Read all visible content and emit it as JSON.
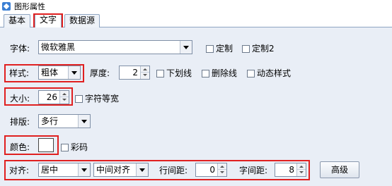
{
  "window": {
    "title": "图形属性",
    "icon": "shape-properties-icon"
  },
  "tabs": [
    {
      "label": "基本",
      "active": false
    },
    {
      "label": "文字",
      "active": true
    },
    {
      "label": "数据源",
      "active": false
    }
  ],
  "font": {
    "label": "字体:",
    "value": "微软雅黑",
    "custom1_label": "定制",
    "custom2_label": "定制2"
  },
  "style": {
    "label": "样式:",
    "value": "粗体",
    "thickness_label": "厚度:",
    "thickness_value": "2",
    "underline_label": "下划线",
    "strikethrough_label": "删除线",
    "dynamic_label": "动态样式"
  },
  "size": {
    "label": "大小:",
    "value": "26",
    "equal_width_label": "字符等宽"
  },
  "layout": {
    "label": "排版:",
    "value": "多行"
  },
  "color": {
    "label": "颜色:",
    "swatch": "#ffffff",
    "colorful_label": "彩码"
  },
  "align": {
    "label": "对齐:",
    "horizontal_value": "居中",
    "vertical_value": "中间对齐",
    "line_spacing_label": "行间距:",
    "line_spacing_value": "0",
    "char_spacing_label": "字间距:",
    "char_spacing_value": "8",
    "advanced_label": "高级"
  },
  "colors": {
    "highlight": "#e02020",
    "panel_bg": "#e9eef6"
  }
}
